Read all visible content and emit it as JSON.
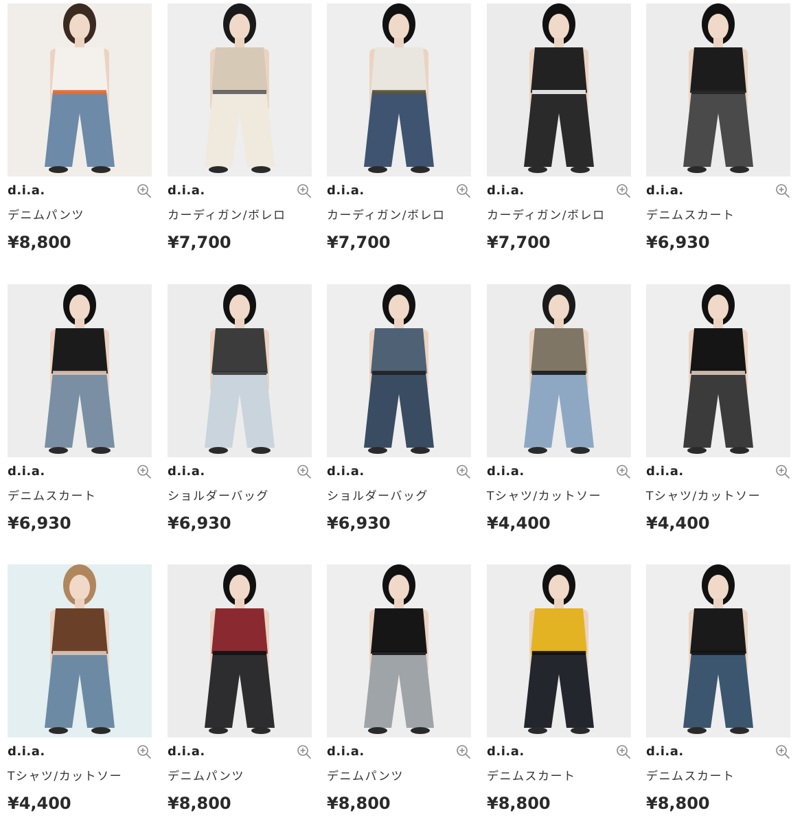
{
  "icons": {
    "zoom": "zoom-in-icon"
  },
  "products": [
    {
      "brand": "d.i.a.",
      "category": "デニムパンツ",
      "price": "¥8,800",
      "bg": "#f1eee9",
      "top": "#f4f1ec",
      "bottom": "#6d8aa8",
      "accent": "#f06a2a",
      "hair": "#3a2a20"
    },
    {
      "brand": "d.i.a.",
      "category": "カーディガン/ボレロ",
      "price": "¥7,700",
      "bg": "#eeeeee",
      "top": "#d6cab7",
      "bottom": "#efe9de",
      "accent": "#555555",
      "hair": "#1a1a1a"
    },
    {
      "brand": "d.i.a.",
      "category": "カーディガン/ボレロ",
      "price": "¥7,700",
      "bg": "#eeeeee",
      "top": "#e9e6df",
      "bottom": "#3f5470",
      "accent": "#5c5638",
      "hair": "#111111"
    },
    {
      "brand": "d.i.a.",
      "category": "カーディガン/ボレロ",
      "price": "¥7,700",
      "bg": "#ebebeb",
      "top": "#222222",
      "bottom": "#2a2a2a",
      "accent": "#ffffff",
      "hair": "#111111"
    },
    {
      "brand": "d.i.a.",
      "category": "デニムスカート",
      "price": "¥6,930",
      "bg": "#ececec",
      "top": "#1c1c1c",
      "bottom": "#4a4a4a",
      "accent": "#222222",
      "hair": "#111111"
    },
    {
      "brand": "d.i.a.",
      "category": "デニムスカート",
      "price": "¥6,930",
      "bg": "#ededed",
      "top": "#1b1b1b",
      "bottom": "#7a8fa3",
      "accent": "#e2c4b0",
      "hair": "#111111"
    },
    {
      "brand": "d.i.a.",
      "category": "ショルダーバッグ",
      "price": "¥6,930",
      "bg": "#ececec",
      "top": "#3c3c3c",
      "bottom": "#c9d4dc",
      "accent": "#2f2f2f",
      "hair": "#111111"
    },
    {
      "brand": "d.i.a.",
      "category": "ショルダーバッグ",
      "price": "¥6,930",
      "bg": "#eeeeee",
      "top": "#4f6175",
      "bottom": "#3a4c62",
      "accent": "#1e1e1e",
      "hair": "#111111"
    },
    {
      "brand": "d.i.a.",
      "category": "Tシャツ/カットソー",
      "price": "¥4,400",
      "bg": "#ececec",
      "top": "#7f7665",
      "bottom": "#8ea8c4",
      "accent": "#111111",
      "hair": "#1a1a1a"
    },
    {
      "brand": "d.i.a.",
      "category": "Tシャツ/カットソー",
      "price": "¥4,400",
      "bg": "#eeeeee",
      "top": "#151515",
      "bottom": "#3b3b3b",
      "accent": "#e6cfc0",
      "hair": "#111111"
    },
    {
      "brand": "d.i.a.",
      "category": "Tシャツ/カットソー",
      "price": "¥4,400",
      "bg": "#e3eff0",
      "top": "#6a4028",
      "bottom": "#6d8aa5",
      "accent": "#e4c5b4",
      "hair": "#b0865c"
    },
    {
      "brand": "d.i.a.",
      "category": "デニムパンツ",
      "price": "¥8,800",
      "bg": "#ececec",
      "top": "#8a2a30",
      "bottom": "#2d2d2f",
      "accent": "#111111",
      "hair": "#111111"
    },
    {
      "brand": "d.i.a.",
      "category": "デニムパンツ",
      "price": "¥8,800",
      "bg": "#eeeeee",
      "top": "#161616",
      "bottom": "#9fa4a8",
      "accent": "#111111",
      "hair": "#111111"
    },
    {
      "brand": "d.i.a.",
      "category": "デニムスカート",
      "price": "¥8,800",
      "bg": "#ededed",
      "top": "#e3b323",
      "bottom": "#23272d",
      "accent": "#111111",
      "hair": "#111111"
    },
    {
      "brand": "d.i.a.",
      "category": "デニムスカート",
      "price": "¥8,800",
      "bg": "#eeeeee",
      "top": "#1a1a1a",
      "bottom": "#3c5670",
      "accent": "#111111",
      "hair": "#111111"
    }
  ]
}
